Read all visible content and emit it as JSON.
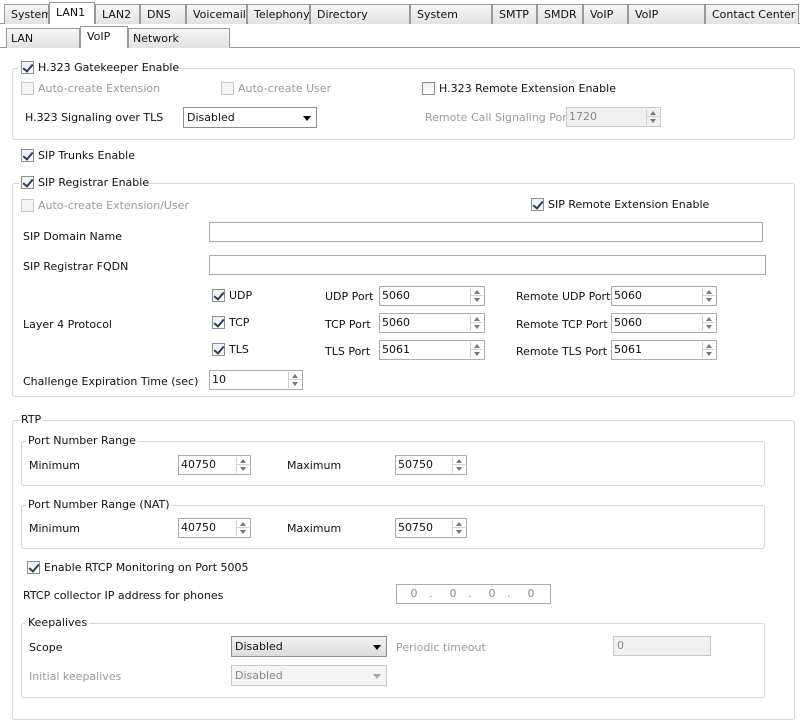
{
  "tabs_top": [
    "System",
    "LAN1",
    "LAN2",
    "DNS",
    "Voicemail",
    "Telephony",
    "Directory Services",
    "System Events",
    "SMTP",
    "SMDR",
    "VoIP",
    "VoIP Security",
    "Contact Center"
  ],
  "tabs_sub": [
    "LAN Settings",
    "VoIP",
    "Network Topology"
  ],
  "h323": {
    "gatekeeper_label": "H.323 Gatekeeper Enable",
    "auto_ext_label": "Auto-create Extension",
    "auto_user_label": "Auto-create User",
    "remote_ext_label": "H.323 Remote Extension Enable",
    "tls_label": "H.323 Signaling over TLS",
    "tls_value": "Disabled",
    "remote_port_label": "Remote Call Signaling Port",
    "remote_port_value": "1720"
  },
  "sip": {
    "trunks_label": "SIP Trunks Enable",
    "registrar_label": "SIP Registrar Enable",
    "auto_ext_user_label": "Auto-create Extension/User",
    "remote_ext_label": "SIP Remote Extension Enable",
    "domain_label": "SIP Domain Name",
    "domain_value": "",
    "fqdn_label": "SIP Registrar FQDN",
    "fqdn_value": "",
    "layer4_label": "Layer 4 Protocol",
    "udp_label": "UDP",
    "tcp_label": "TCP",
    "tls_label": "TLS",
    "udp_port_label": "UDP Port",
    "udp_port": "5060",
    "tcp_port_label": "TCP Port",
    "tcp_port": "5060",
    "tls_port_label": "TLS Port",
    "tls_port": "5061",
    "remote_udp_label": "Remote UDP Port",
    "remote_udp": "5060",
    "remote_tcp_label": "Remote TCP Port",
    "remote_tcp": "5060",
    "remote_tls_label": "Remote TLS Port",
    "remote_tls": "5061",
    "challenge_label": "Challenge Expiration Time (sec)",
    "challenge_value": "10"
  },
  "rtp": {
    "title": "RTP",
    "range_title": "Port Number Range",
    "min_label": "Minimum",
    "min_value": "40750",
    "max_label": "Maximum",
    "max_value": "50750",
    "nat_title": "Port Number Range (NAT)",
    "nat_min_label": "Minimum",
    "nat_min_value": "40750",
    "nat_max_label": "Maximum",
    "nat_max_value": "50750",
    "rtcp_label": "Enable RTCP Monitoring on Port 5005",
    "collector_label": "RTCP collector IP address for phones",
    "ip": [
      "0",
      "0",
      "0",
      "0"
    ],
    "keepalives_title": "Keepalives",
    "scope_label": "Scope",
    "scope_value": "Disabled",
    "periodic_label": "Periodic timeout",
    "periodic_value": "0",
    "initial_label": "Initial keepalives",
    "initial_value": "Disabled"
  }
}
